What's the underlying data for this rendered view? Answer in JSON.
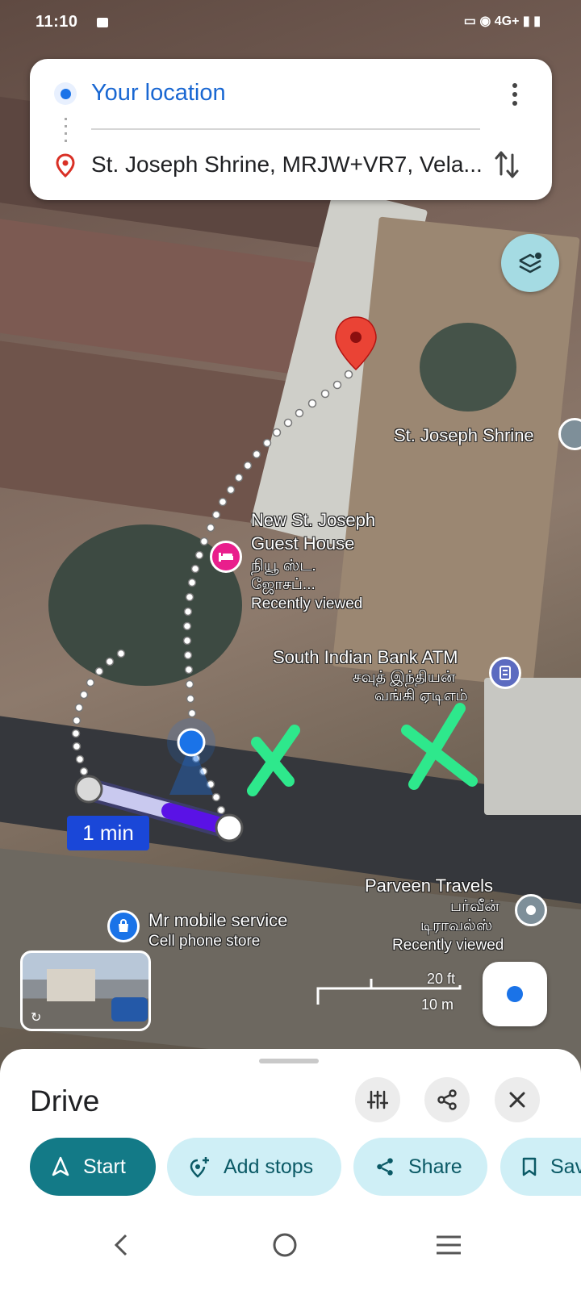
{
  "status_bar": {
    "time": "11:10",
    "network": "4G+"
  },
  "directions": {
    "origin": "Your location",
    "destination": "St. Joseph Shrine, MRJW+VR7, Vela..."
  },
  "map": {
    "labels": {
      "st_joseph_shrine": "St. Joseph Shrine",
      "guest_house_line1": "New St. Joseph",
      "guest_house_line2": "Guest House",
      "guest_house_tamil1": "நியூ ஸ்ட.",
      "guest_house_tamil2": "ஜோசப்...",
      "guest_house_note": "Recently viewed",
      "atm_name": "South Indian Bank ATM",
      "atm_tamil1": "சவுத் இந்தியன்",
      "atm_tamil2": "வங்கி ஏடிஎம்",
      "travels_name": "Parveen Travels",
      "travels_tamil1": "பர்வீன்",
      "travels_tamil2": "டிராவல்ஸ்",
      "travels_note": "Recently viewed",
      "mobile_name": "Mr mobile service",
      "mobile_type": "Cell phone store"
    },
    "route_duration": "1 min",
    "scale": {
      "feet": "20 ft",
      "meters": "10 m"
    }
  },
  "sheet": {
    "title": "Drive",
    "chips": {
      "start": "Start",
      "add_stops": "Add stops",
      "share": "Share",
      "save": "Save"
    }
  },
  "colors": {
    "accent": "#1a73e8",
    "primary_chip": "#137a87",
    "secondary_chip": "#cfeff6",
    "destination_pin": "#ea4335",
    "route": "#1a47d8",
    "annotation": "#2ee88c"
  }
}
